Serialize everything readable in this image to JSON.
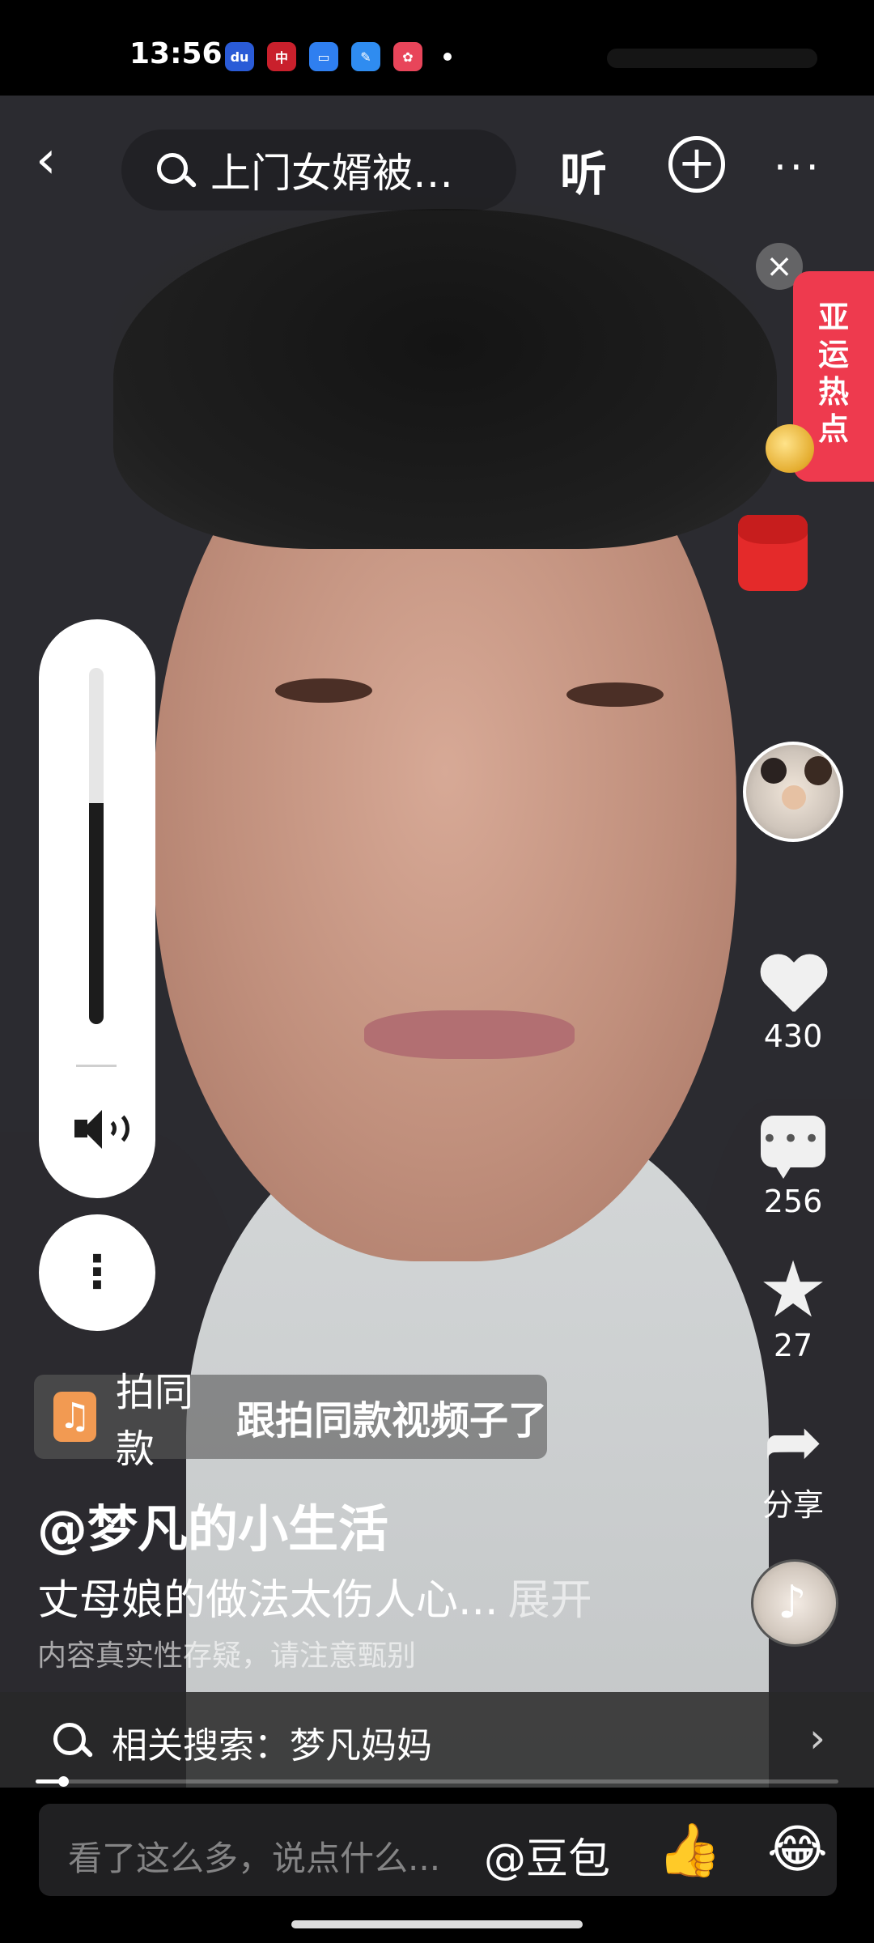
{
  "status_bar": {
    "time": "13:56",
    "apps": [
      {
        "icon": "baidu-app-icon",
        "text": "du",
        "color": "#2a5bd7"
      },
      {
        "icon": "bank-app-icon",
        "text": "中",
        "color": "#c9202c"
      },
      {
        "icon": "folder-app-icon",
        "text": "▭",
        "color": "#2f7ff0"
      },
      {
        "icon": "browser-app-icon",
        "text": "✎",
        "color": "#2f8cf0"
      },
      {
        "icon": "game-app-icon",
        "text": "✿",
        "color": "#e8455a"
      }
    ]
  },
  "top_nav": {
    "search_text": "上门女婿被…",
    "listen_label": "听",
    "plus_icon": "+",
    "more_icon": "···"
  },
  "widgets": {
    "asian_games_label": "亚运热点"
  },
  "actions": {
    "likes": "430",
    "comments": "256",
    "favorites": "27",
    "share_label": "分享"
  },
  "volume": {
    "level": 0.62
  },
  "video_info": {
    "same_style_label": "拍同款",
    "same_style_song": "跟拍同款视频子了",
    "author": "@梦凡的小生活",
    "description": "丈母娘的做法太伤人心...",
    "expand_label": "展开",
    "notice": "内容真实性存疑，请注意甄别"
  },
  "related_search": {
    "text": "相关搜索：梦凡妈妈",
    "chevron": "›"
  },
  "playback": {
    "progress": 0.034
  },
  "comment_bar": {
    "placeholder": "看了这么多，说点什么...",
    "doubao_label": "@豆包",
    "thumb_emoji": "👍",
    "laugh_emoji": "😂"
  },
  "colors": {
    "accent_red": "#ee3a4e",
    "note_orange": "#f29a52"
  }
}
